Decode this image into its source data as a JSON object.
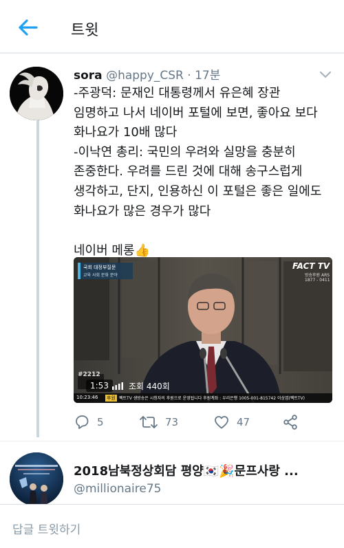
{
  "header": {
    "title": "트윗",
    "back_icon": "back-arrow-icon",
    "accent": "#1da1f2"
  },
  "tweet": {
    "name": "sora",
    "handle": "@happy_CSR",
    "separator": "·",
    "time": "17분",
    "lines": [
      "-주광덕: 문재인 대통령께서 유은혜 장관",
      "임명하고 나서 네이버 포털에 보면, 좋아요 보다",
      "화나요가 10배 많다",
      "-이낙연 총리: 국민의 우려와 실망을 충분히",
      "존중한다. 우려를 드린 것에 대해 송구스럽게",
      "생각하고, 단지, 인용하신 이 포털은 좋은 일에도",
      "화나요가 많은 경우가 많다",
      "",
      "네이버 메롱👍"
    ],
    "media": {
      "broadcast_logo": "FACT TV",
      "broadcast_sub": "방송후원 ARS",
      "broadcast_number": "1877 - 0411",
      "overlay_title": "국회 대정부질문",
      "overlay_sub": "교육 사회 문화 분야",
      "duration": "1:53",
      "views": "조회 440회",
      "clock": "10:23:46",
      "ticker_tag": "후원",
      "ticker": "팩트TV 생방송은 시청자의 후원으로 운영됩니다 후원계좌 : 우리은행 1005-001-815742 이상엽(팩트TV)",
      "channel_badge": "#2212"
    },
    "actions": {
      "reply_count": "5",
      "retweet_count": "73",
      "like_count": "47"
    },
    "colors": {
      "text": "#14171a",
      "muted": "#657786",
      "thread_line": "#ccd6dd"
    }
  },
  "next_tweet": {
    "title": "2018남북정상회담 평양🇰🇷🎉문프사랑 ...",
    "handle": "@millionaire75"
  },
  "reply": {
    "placeholder": "답글 트윗하기"
  }
}
